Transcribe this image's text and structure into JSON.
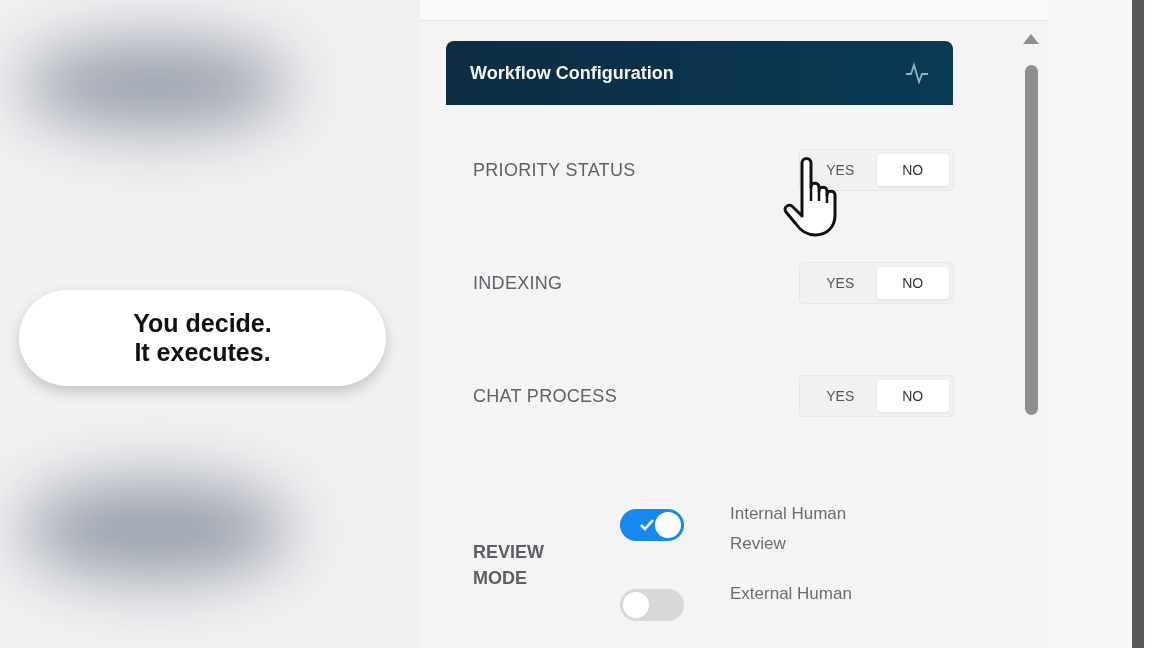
{
  "callout": {
    "lines": [
      "You decide.",
      "It executes."
    ]
  },
  "panel": {
    "title": "Workflow Configuration",
    "settings": [
      {
        "label": "PRIORITY STATUS",
        "cursor": true,
        "options": [
          {
            "label": "YES",
            "selected": false
          },
          {
            "label": "NO",
            "selected": true
          }
        ]
      },
      {
        "label": "INDEXING",
        "cursor": false,
        "options": [
          {
            "label": "YES",
            "selected": false
          },
          {
            "label": "NO",
            "selected": true
          }
        ]
      },
      {
        "label": "CHAT PROCESS",
        "cursor": false,
        "options": [
          {
            "label": "YES",
            "selected": false
          },
          {
            "label": "NO",
            "selected": true
          }
        ]
      }
    ],
    "review_mode": {
      "label": "REVIEW MODE",
      "options": [
        {
          "label": "Internal Human Review",
          "on": true
        },
        {
          "label": "External Human",
          "on": false
        }
      ]
    }
  }
}
